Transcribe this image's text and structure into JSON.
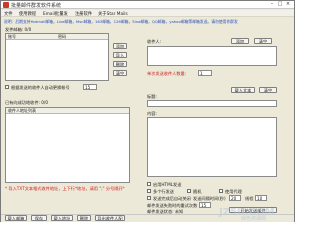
{
  "window": {
    "title": "批量邮件群发软件系统",
    "minimize": "–",
    "maximize": "□",
    "close": "×"
  },
  "menu": [
    "文件",
    "使用教程",
    "Email批量发",
    "注册软件",
    "关于Star Mails"
  ],
  "notice": "说明：后期支持Hotmail邮箱，Live邮箱，Msn邮箱，163邮箱，126邮箱，Sina邮箱，QQ邮箱，yahoo邮箱等邮箱发送。请勿使用作群发",
  "left": {
    "sender_label": "发件邮箱: 0/0",
    "sender_columns": [
      "账号",
      "密码"
    ],
    "add_button": "添加",
    "import_button": "导入",
    "delete_button": "删除",
    "clear_button": "清空",
    "switch_checkbox_label": "根据发送的收件人自动更换帐号",
    "switch_value": "15",
    "recipients_label": "已有向成功地收件: 0/0",
    "recipients_columns": [
      "收件人地址列表"
    ],
    "tip": "* 导入TXT文本格式收件地址，上下行*地址，请用 \";\" 分号隔开*",
    "import_recipients_button": "载入地址",
    "clear_recipients_button": "删除",
    "export_button": "导出收件人配"
  },
  "right": {
    "recipient_label": "收件人:",
    "add_button": "添加",
    "clear_button": "清空",
    "count_label": "单次发送收件人数量:",
    "count_value": "1",
    "subject_label": "标题:",
    "load_text_button": "载入文本",
    "clear_text_button": "清空",
    "body_label": "内容:",
    "options": [
      {
        "label": "启用HTML发送",
        "checked": false
      },
      {
        "label": "多个行发送",
        "checked": false
      },
      {
        "label": "随机",
        "checked": false
      },
      {
        "label": "使用代理",
        "checked": false
      },
      {
        "label": "发送完成后自动关闭",
        "checked": false
      }
    ],
    "interval_label": "发送间隔时间(秒)",
    "interval_value": "20",
    "thread_label": "线程",
    "thread_value": "10",
    "retry_label": "邮件发送失败时的重试次数",
    "retry_value": "15",
    "status_label": "邮件发送状态: 未知",
    "send_button": "开始发送邮件"
  },
  "footer": {
    "load_button": "载入邮箱",
    "save_button": "保存"
  },
  "watermark": {
    "text": "JZ5U.COM",
    "subtext": "绿色资源网"
  }
}
